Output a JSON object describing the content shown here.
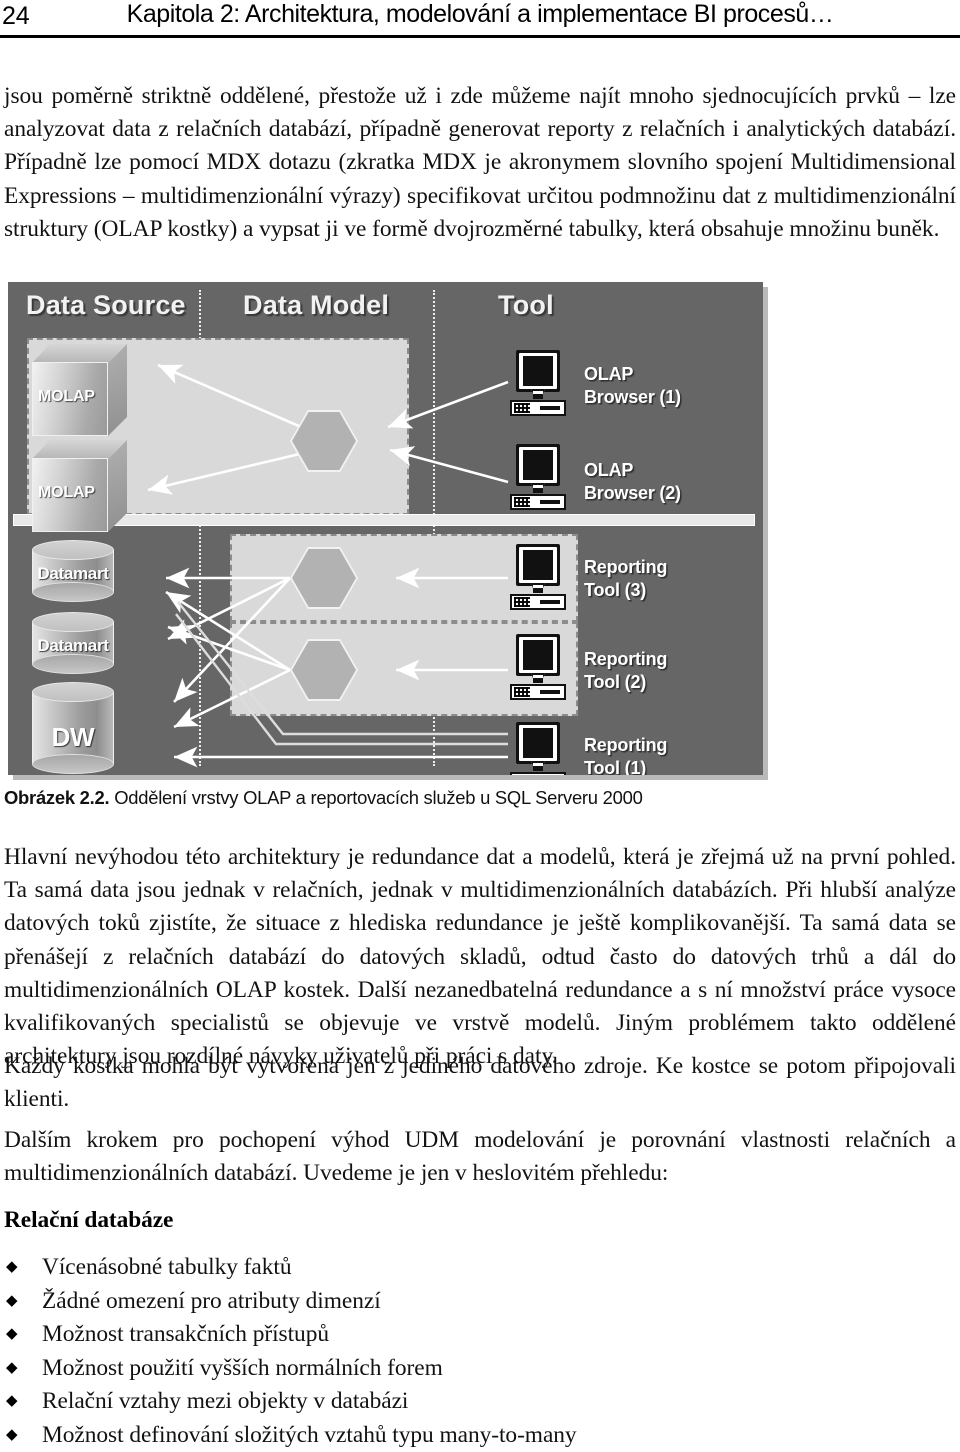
{
  "header": {
    "page_number": "24",
    "title": "Kapitola 2: Architektura, modelování a implementace BI procesů…"
  },
  "body": {
    "paragraph_1": "jsou poměrně striktně oddělené, přestože už i zde můžeme najít mnoho sjednocujících prvků – lze analyzovat data z relačních databází, případně generovat reporty z relačních i analytických databází. Případně lze pomocí MDX dotazu (zkratka MDX je akronymem slovního spojení Multidimensional Expressions – multidimenzionální výrazy) specifikovat určitou podmnožinu dat z multidimenzionální struktury (OLAP kostky) a vypsat ji ve formě dvojrozměrné tabulky, která obsahuje množinu buněk.",
    "caption_label": "Obrázek 2.2.",
    "caption_text": " Oddělení vrstvy OLAP a reportovacích služeb u SQL Serveru 2000",
    "paragraph_2": "Hlavní nevýhodou této architektury je redundance dat a modelů, která je zřejmá už na první pohled. Ta samá data jsou jednak v relačních, jednak v multidimenzionálních databázích. Při hlubší analýze datových toků zjistíte, že situace z hlediska redundance je ještě komplikovanější. Ta samá data se přenášejí z relačních databází do datových skladů, odtud často do datových trhů a dál do multidimenzionálních OLAP kostek. Další nezanedbatelná redundance a s ní množství práce vysoce kvalifikovaných specialistů se objevuje ve vrstvě modelů. Jiným problémem takto oddělené architektury jsou rozdílné návyky uživatelů při práci s daty.",
    "paragraph_3": "Každý kostka mohla být vytvořena jen z jediného datového zdroje. Ke kostce se potom připojovali klienti.",
    "paragraph_4": "Dalším krokem pro pochopení výhod UDM modelování je porovnání vlastnosti relačních a multidimenzionálních databází. Uvedeme je jen v heslovitém přehledu:",
    "subheading": "Relační databáze",
    "bullet_marker": "◆",
    "bullets": [
      "Vícenásobné tabulky faktů",
      "Žádné omezení pro atributy dimenzí",
      "Možnost transakčních přístupů",
      "Možnost použití vyšších normálních forem",
      "Relační vztahy mezi objekty v databázi",
      "Možnost definování složitých vztahů typu many-to-many"
    ]
  },
  "figure": {
    "zones": [
      {
        "label": "Data Source"
      },
      {
        "label": "Data Model"
      },
      {
        "label": "Tool"
      }
    ],
    "data_sources": [
      {
        "label": "MOLAP",
        "shape": "cube"
      },
      {
        "label": "MOLAP",
        "shape": "cube"
      },
      {
        "label": "Datamart",
        "shape": "cylinder"
      },
      {
        "label": "Datamart",
        "shape": "cylinder"
      },
      {
        "label": "DW",
        "shape": "cylinder"
      }
    ],
    "tools": [
      {
        "label": "OLAP\nBrowser (1)"
      },
      {
        "label": "OLAP\nBrowser (2)"
      },
      {
        "label": "Reporting\nTool (3)"
      },
      {
        "label": "Reporting\nTool (2)"
      },
      {
        "label": "Reporting\nTool (1)"
      }
    ],
    "colors": {
      "background": "#666666",
      "panel": "#d9d9d9",
      "panel_border": "#8c8c8c",
      "arrow": "#ffffff",
      "zone_text": "#f2f2f2"
    }
  }
}
